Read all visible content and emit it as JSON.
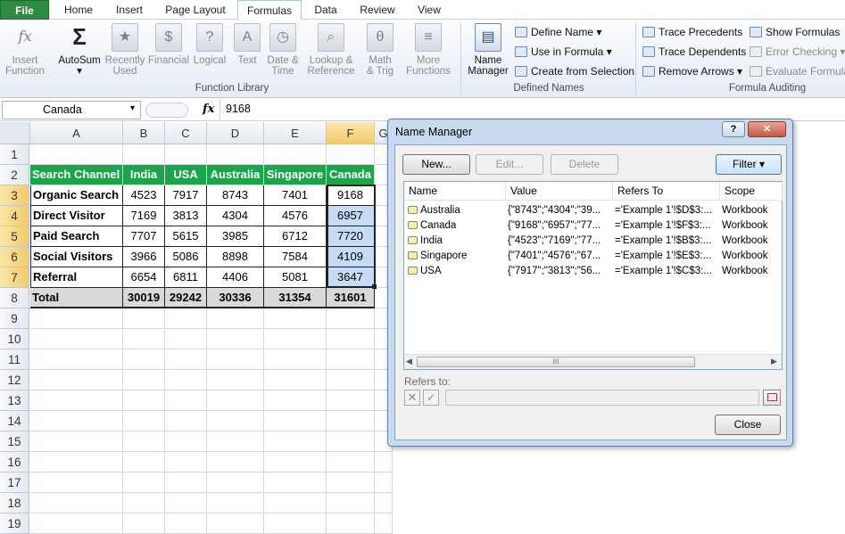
{
  "tabs": {
    "file": "File",
    "home": "Home",
    "insert": "Insert",
    "page_layout": "Page Layout",
    "formulas": "Formulas",
    "data": "Data",
    "review": "Review",
    "view": "View"
  },
  "ribbon": {
    "function_library": {
      "label": "Function Library",
      "insert_function": [
        "Insert",
        "Function"
      ],
      "autosum": "AutoSum",
      "recently_used": [
        "Recently",
        "Used"
      ],
      "financial": "Financial",
      "logical": "Logical",
      "text": "Text",
      "date_time": [
        "Date &",
        "Time"
      ],
      "lookup": [
        "Lookup &",
        "Reference"
      ],
      "math": [
        "Math",
        "& Trig"
      ],
      "more": [
        "More",
        "Functions"
      ]
    },
    "defined_names": {
      "label": "Defined Names",
      "name_manager": [
        "Name",
        "Manager"
      ],
      "define_name": "Define Name",
      "use_in_formula": "Use in Formula",
      "create_from_selection": "Create from Selection"
    },
    "formula_auditing": {
      "label": "Formula Auditing",
      "trace_precedents": "Trace Precedents",
      "trace_dependents": "Trace Dependents",
      "remove_arrows": "Remove Arrows",
      "show_formulas": "Show Formulas",
      "error_checking": "Error Checking",
      "evaluate_formula": "Evaluate Formula"
    }
  },
  "formula_bar": {
    "name_box": "Canada",
    "fx": "fx",
    "value": "9168"
  },
  "sheet": {
    "columns": [
      "A",
      "B",
      "C",
      "D",
      "E",
      "F",
      "G"
    ],
    "rows": [
      "1",
      "2",
      "3",
      "4",
      "5",
      "6",
      "7",
      "8",
      "9",
      "10",
      "11",
      "12",
      "13",
      "14",
      "15",
      "16",
      "17",
      "18",
      "19"
    ],
    "headers": [
      "Search Channel",
      "India",
      "USA",
      "Australia",
      "Singapore",
      "Canada"
    ],
    "data": [
      [
        "Organic Search",
        "4523",
        "7917",
        "8743",
        "7401",
        "9168"
      ],
      [
        "Direct Visitor",
        "7169",
        "3813",
        "4304",
        "4576",
        "6957"
      ],
      [
        "Paid Search",
        "7707",
        "5615",
        "3985",
        "6712",
        "7720"
      ],
      [
        "Social Visitors",
        "3966",
        "5086",
        "8898",
        "7584",
        "4109"
      ],
      [
        "Referral",
        "6654",
        "6811",
        "4406",
        "5081",
        "3647"
      ]
    ],
    "totals": [
      "Total",
      "30019",
      "29242",
      "30336",
      "31354",
      "31601"
    ]
  },
  "dialog": {
    "title": "Name Manager",
    "help": "?",
    "close": "✕",
    "new": "New...",
    "edit": "Edit...",
    "delete": "Delete",
    "filter": "Filter ▾",
    "columns": [
      "Name",
      "Value",
      "Refers To",
      "Scope"
    ],
    "names": [
      [
        "Australia",
        "{\"8743\";\"4304\";\"39...",
        "='Example 1'!$D$3:...",
        "Workbook"
      ],
      [
        "Canada",
        "{\"9168\";\"6957\";\"77...",
        "='Example 1'!$F$3:...",
        "Workbook"
      ],
      [
        "India",
        "{\"4523\";\"7169\";\"77...",
        "='Example 1'!$B$3:...",
        "Workbook"
      ],
      [
        "Singapore",
        "{\"7401\";\"4576\";\"67...",
        "='Example 1'!$E$3:...",
        "Workbook"
      ],
      [
        "USA",
        "{\"7917\";\"3813\";\"56...",
        "='Example 1'!$C$3:...",
        "Workbook"
      ]
    ],
    "refers_to_label": "Refers to:",
    "close_button": "Close",
    "scroll_grip": "III"
  },
  "colors": {
    "header_green": "#1da44a",
    "selection_blue": "#c6dcf5",
    "file_tab": "#2e8b3f"
  }
}
